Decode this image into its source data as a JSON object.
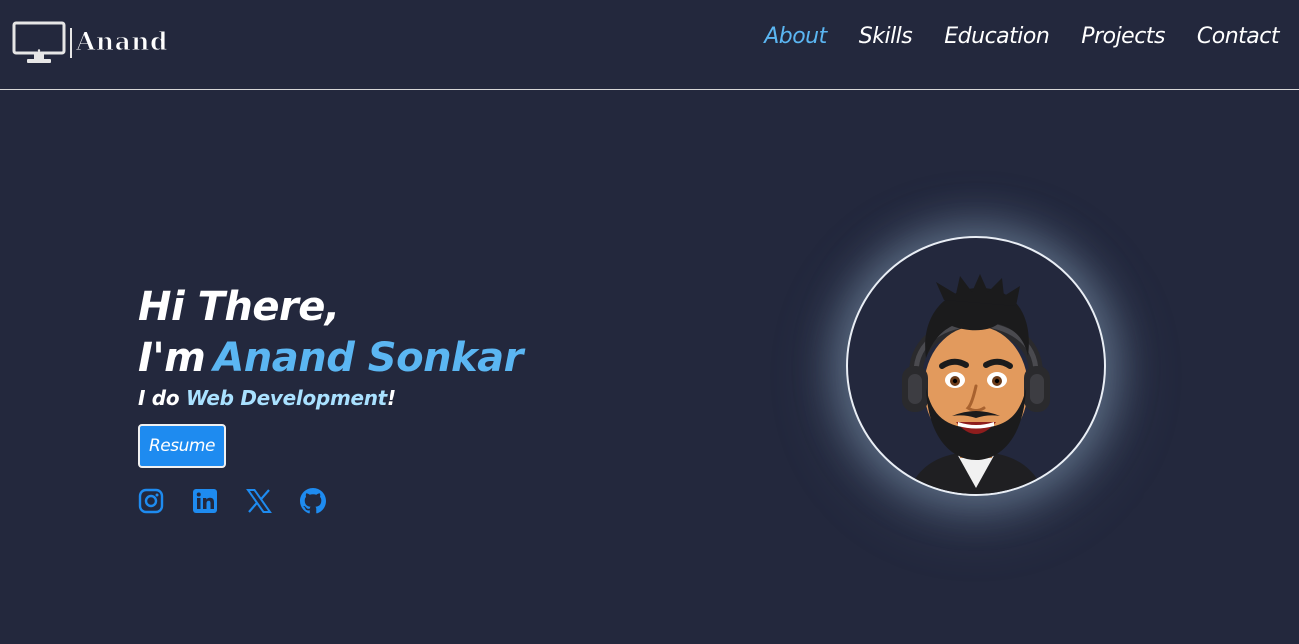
{
  "brand": {
    "name": "Anand",
    "icon": "monitor-icon"
  },
  "nav": {
    "items": [
      {
        "label": "About",
        "active": true
      },
      {
        "label": "Skills",
        "active": false
      },
      {
        "label": "Education",
        "active": false
      },
      {
        "label": "Projects",
        "active": false
      },
      {
        "label": "Contact",
        "active": false
      }
    ]
  },
  "hero": {
    "greeting": "Hi There,",
    "intro": "I'm",
    "name": "Anand Sonkar",
    "tagline_prefix": "I do ",
    "tagline_role": "Web Development",
    "tagline_suffix": "!",
    "resume_label": "Resume"
  },
  "socials": [
    {
      "icon": "instagram-icon"
    },
    {
      "icon": "linkedin-icon"
    },
    {
      "icon": "x-icon"
    },
    {
      "icon": "github-icon"
    }
  ],
  "colors": {
    "background": "#23283d",
    "accent": "#5bb6f2",
    "button": "#1e8bf0",
    "social_icon": "#1e8bf0"
  }
}
